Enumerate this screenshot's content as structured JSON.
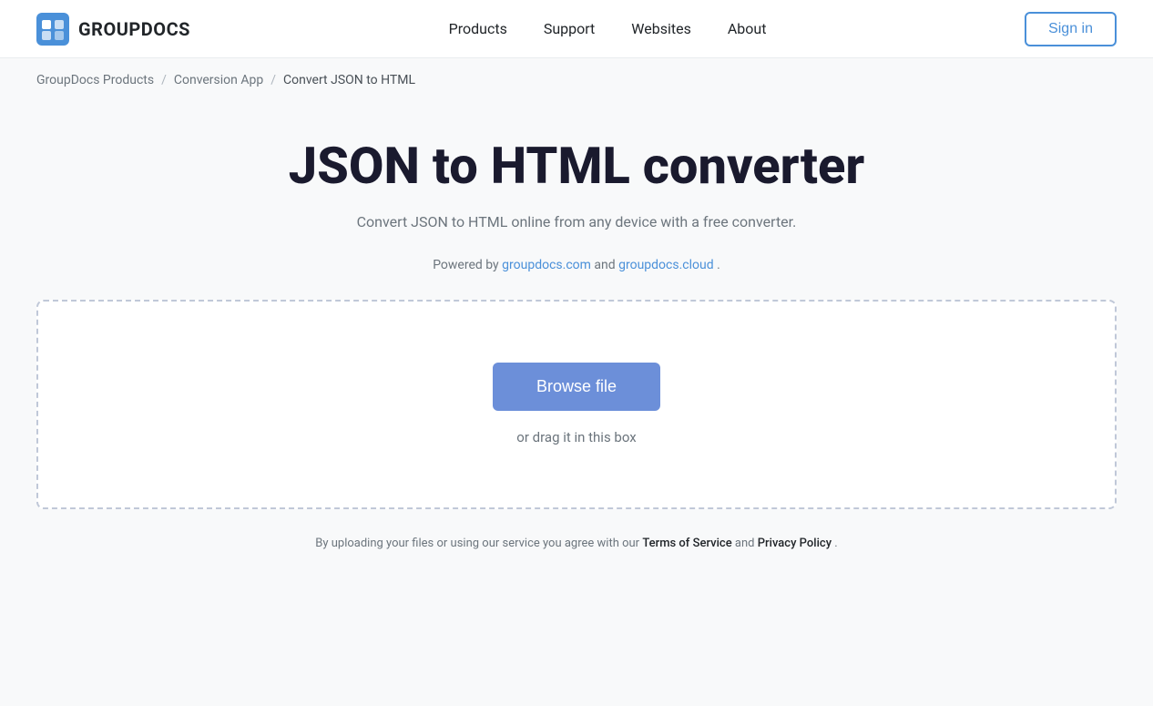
{
  "header": {
    "logo_text": "GROUPDOCS",
    "nav": {
      "items": [
        "Products",
        "Support",
        "Websites",
        "About"
      ],
      "sign_in_label": "Sign in"
    }
  },
  "breadcrumb": {
    "items": [
      {
        "label": "GroupDocs Products",
        "href": "#"
      },
      {
        "label": "Conversion App",
        "href": "#"
      },
      {
        "label": "Convert JSON to HTML",
        "href": null
      }
    ],
    "separator": "/"
  },
  "main": {
    "title": "JSON to HTML converter",
    "subtitle": "Convert JSON to HTML online from any device with a free converter.",
    "powered_by_prefix": "Powered by ",
    "powered_by_links": [
      {
        "label": "groupdocs.com",
        "href": "#"
      },
      {
        "label": "groupdocs.cloud",
        "href": "#"
      }
    ],
    "powered_by_suffix": ".",
    "drop_zone": {
      "browse_label": "Browse file",
      "drag_label": "or drag it in this box"
    },
    "footer_note_prefix": "By uploading your files or using our service you agree with our ",
    "footer_note_tos": "Terms of Service",
    "footer_note_and": " and ",
    "footer_note_pp": "Privacy Policy",
    "footer_note_suffix": "."
  }
}
